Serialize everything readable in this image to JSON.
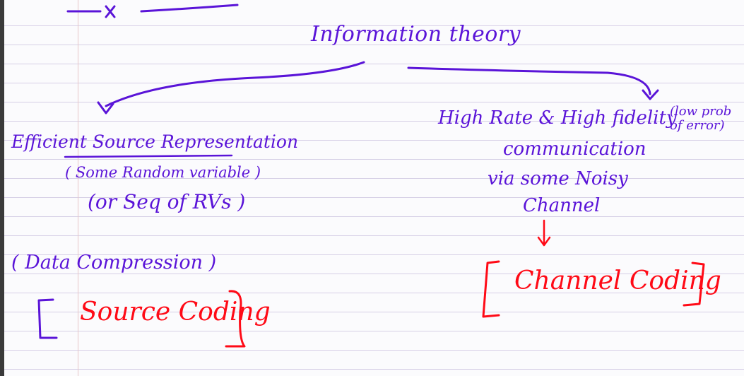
{
  "notes": {
    "title": "Information theory",
    "top_mark": "x",
    "left": {
      "line1": "Efficient Source Representation",
      "line2": "( Some Random variable )",
      "line3": "(or Seq of RVs )",
      "line4": "( Data Compression )",
      "result": "Source Coding"
    },
    "right": {
      "line1": "High Rate & High fidelity",
      "line1_note": "(low prob of error)",
      "line2": "communication",
      "line3": "via some Noisy",
      "line4": "Channel",
      "result": "Channel Coding"
    }
  },
  "colors": {
    "ink_purple": "#5a14d8",
    "ink_red": "#ff0a16",
    "rule_lines": "#d6cfe6"
  }
}
